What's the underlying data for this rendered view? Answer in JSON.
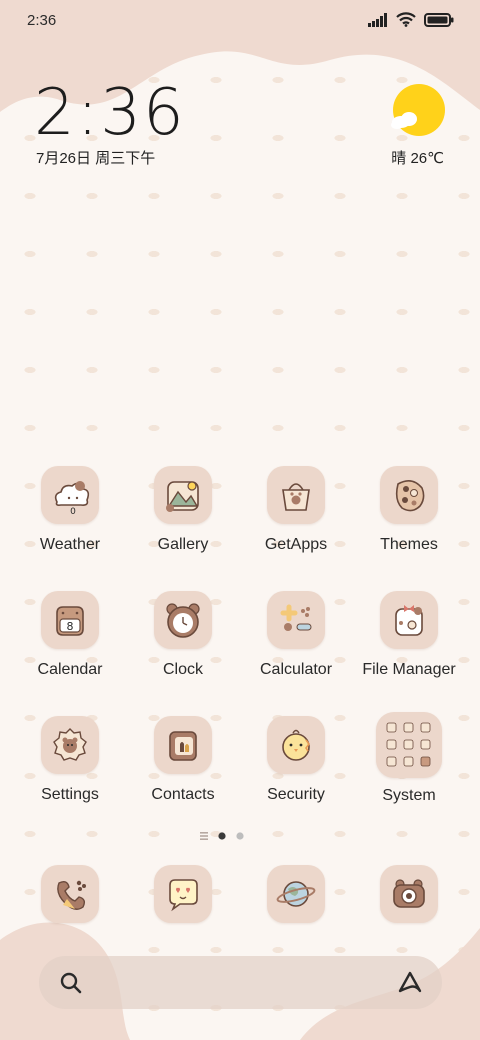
{
  "status_bar": {
    "time": "2:36"
  },
  "clock_widget": {
    "time": "2:36",
    "date": "7月26日 周三下午"
  },
  "weather_widget": {
    "text": "晴 26℃"
  },
  "apps": [
    {
      "label": "Weather",
      "icon": "weather-cloud-icon"
    },
    {
      "label": "Gallery",
      "icon": "gallery-landscape-icon"
    },
    {
      "label": "GetApps",
      "icon": "getapps-bag-icon"
    },
    {
      "label": "Themes",
      "icon": "themes-palette-icon"
    },
    {
      "label": "Calendar",
      "icon": "calendar-icon",
      "badge": "8"
    },
    {
      "label": "Clock",
      "icon": "clock-bear-icon"
    },
    {
      "label": "Calculator",
      "icon": "calculator-icon"
    },
    {
      "label": "File Manager",
      "icon": "file-manager-icon"
    },
    {
      "label": "Settings",
      "icon": "settings-gear-icon"
    },
    {
      "label": "Contacts",
      "icon": "contacts-book-icon"
    },
    {
      "label": "Security",
      "icon": "security-chick-icon"
    },
    {
      "label": "System",
      "icon": "system-folder-icon"
    }
  ],
  "weather_icon_badge": "0",
  "page_indicator": {
    "pages": 2,
    "current": 1
  },
  "dock": [
    {
      "icon": "phone-icon"
    },
    {
      "icon": "messages-icon"
    },
    {
      "icon": "browser-planet-icon"
    },
    {
      "icon": "camera-icon"
    }
  ],
  "search_bar": {
    "search_icon": "search-icon",
    "assistant_icon": "assistant-icon"
  },
  "colors": {
    "accent_sun": "#ffd21a",
    "icon_bg": "#ecd7cb",
    "blob": "#efdad0",
    "background": "#fbf6f2"
  }
}
